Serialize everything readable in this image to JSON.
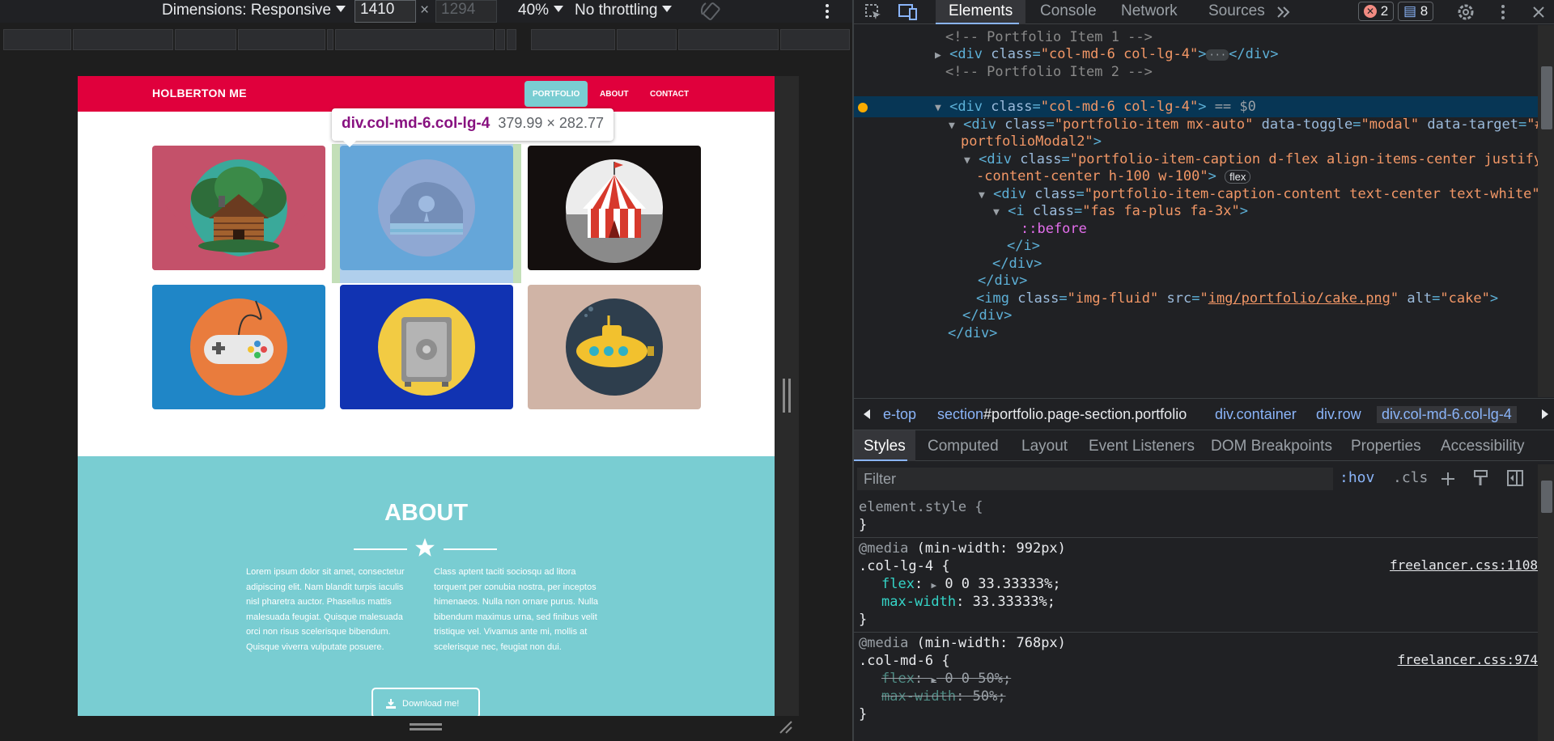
{
  "device_toolbar": {
    "dimensions_label": "Dimensions: Responsive",
    "width_value": "1410",
    "times": "×",
    "height_placeholder": "1294",
    "zoom": "40%",
    "throttling": "No throttling"
  },
  "site": {
    "brand": "HOLBERTON ME",
    "nav": [
      "PORTFOLIO",
      "ABOUT",
      "CONTACT"
    ],
    "tooltip_name": "div.col-md-6.col-lg-4",
    "tooltip_size": "379.99 × 282.77",
    "portfolio_icons": [
      "cabin-icon",
      "cake-icon",
      "circus-tent-icon",
      "game-controller-icon",
      "safe-icon",
      "submarine-icon"
    ],
    "about": {
      "title": "ABOUT",
      "col1": "Lorem ipsum dolor sit amet, consectetur adipiscing elit. Nam blandit turpis iaculis nisl pharetra auctor. Phasellus mattis malesuada feugiat. Quisque malesuada orci non risus scelerisque bibendum. Quisque viverra vulputate posuere.",
      "col2": "Class aptent taciti sociosqu ad litora torquent per conubia nostra, per inceptos himenaeos. Nulla non ornare purus. Nulla bibendum maximus urna, sed finibus velit tristique vel. Vivamus ante mi, mollis at scelerisque nec, feugiat non dui.",
      "download": "Download me!"
    }
  },
  "devtools": {
    "tabs": [
      "Elements",
      "Console",
      "Network",
      "Sources"
    ],
    "errors": "2",
    "messages": "8",
    "dom": {
      "c1": "<!-- Portfolio Item 1 -->",
      "l1_tag_open": "<div",
      "l1_attr": "class",
      "l1_val": "\"col-md-6 col-lg-4\"",
      "l1_tag_close": "</div>",
      "c2": "<!-- Portfolio Item 2 -->",
      "sel_tag": "<div",
      "sel_attr": "class",
      "sel_val": "\"col-md-6 col-lg-4\"",
      "sel_suffix": "== $0",
      "l4_a": "portfolio-item mx-auto",
      "l4_toggle": "modal",
      "l4_target_1": "#",
      "l4_target_2": "portfolioModal2",
      "l5_a": "portfolio-item-caption d-flex align-items-center justify",
      "l5_b": "-content-center h-100 w-100",
      "flex_badge": "flex",
      "l6_a": "portfolio-item-caption-content text-center text-white",
      "l7_a": "fas fa-plus fa-3x",
      "before": "::before",
      "img_class": "img-fluid",
      "img_src": "img/portfolio/cake.png",
      "img_alt": "cake"
    },
    "breadcrumbs": [
      "e-top",
      "section",
      "#portfolio.page-section.portfolio",
      "div.container",
      "div.row",
      "div.col-md-6.col-lg-4"
    ],
    "style_tabs": [
      "Styles",
      "Computed",
      "Layout",
      "Event Listeners",
      "DOM Breakpoints",
      "Properties",
      "Accessibility"
    ],
    "filter_placeholder": "Filter",
    "hov": ":hov",
    "cls": ".cls",
    "styles": {
      "element_style": "element.style {",
      "close": "}",
      "media1": "@media",
      "media1_q": "(min-width: 992px)",
      "rule1_sel": ".col-lg-4 {",
      "rule1_src": "freelancer.css:1108",
      "rule1_flex": "0 0 33.33333%;",
      "rule1_max": "33.33333%;",
      "media2_q": "(min-width: 768px)",
      "rule2_sel": ".col-md-6 {",
      "rule2_src": "freelancer.css:974",
      "rule2_flex": "0 0 50%;",
      "rule2_max": "50%;",
      "prop_flex": "flex",
      "prop_max": "max-width"
    }
  }
}
